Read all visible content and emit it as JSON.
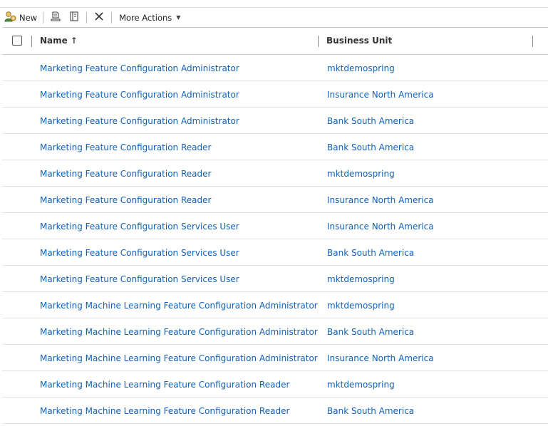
{
  "toolbar": {
    "new_label": "New",
    "more_actions_label": "More Actions"
  },
  "columns": {
    "name": "Name",
    "business_unit": "Business Unit"
  },
  "rows": [
    {
      "name": "Marketing Feature Configuration Administrator",
      "business_unit": "mktdemospring"
    },
    {
      "name": "Marketing Feature Configuration Administrator",
      "business_unit": "Insurance North America"
    },
    {
      "name": "Marketing Feature Configuration Administrator",
      "business_unit": "Bank South America"
    },
    {
      "name": "Marketing Feature Configuration Reader",
      "business_unit": "Bank South America"
    },
    {
      "name": "Marketing Feature Configuration Reader",
      "business_unit": "mktdemospring"
    },
    {
      "name": "Marketing Feature Configuration Reader",
      "business_unit": "Insurance North America"
    },
    {
      "name": "Marketing Feature Configuration Services User",
      "business_unit": "Insurance North America"
    },
    {
      "name": "Marketing Feature Configuration Services User",
      "business_unit": "Bank South America"
    },
    {
      "name": "Marketing Feature Configuration Services User",
      "business_unit": "mktdemospring"
    },
    {
      "name": "Marketing Machine Learning Feature Configuration Administrator",
      "business_unit": "mktdemospring"
    },
    {
      "name": "Marketing Machine Learning Feature Configuration Administrator",
      "business_unit": "Bank South America"
    },
    {
      "name": "Marketing Machine Learning Feature Configuration Administrator",
      "business_unit": "Insurance North America"
    },
    {
      "name": "Marketing Machine Learning Feature Configuration Reader",
      "business_unit": "mktdemospring"
    },
    {
      "name": "Marketing Machine Learning Feature Configuration Reader",
      "business_unit": "Bank South America"
    }
  ]
}
